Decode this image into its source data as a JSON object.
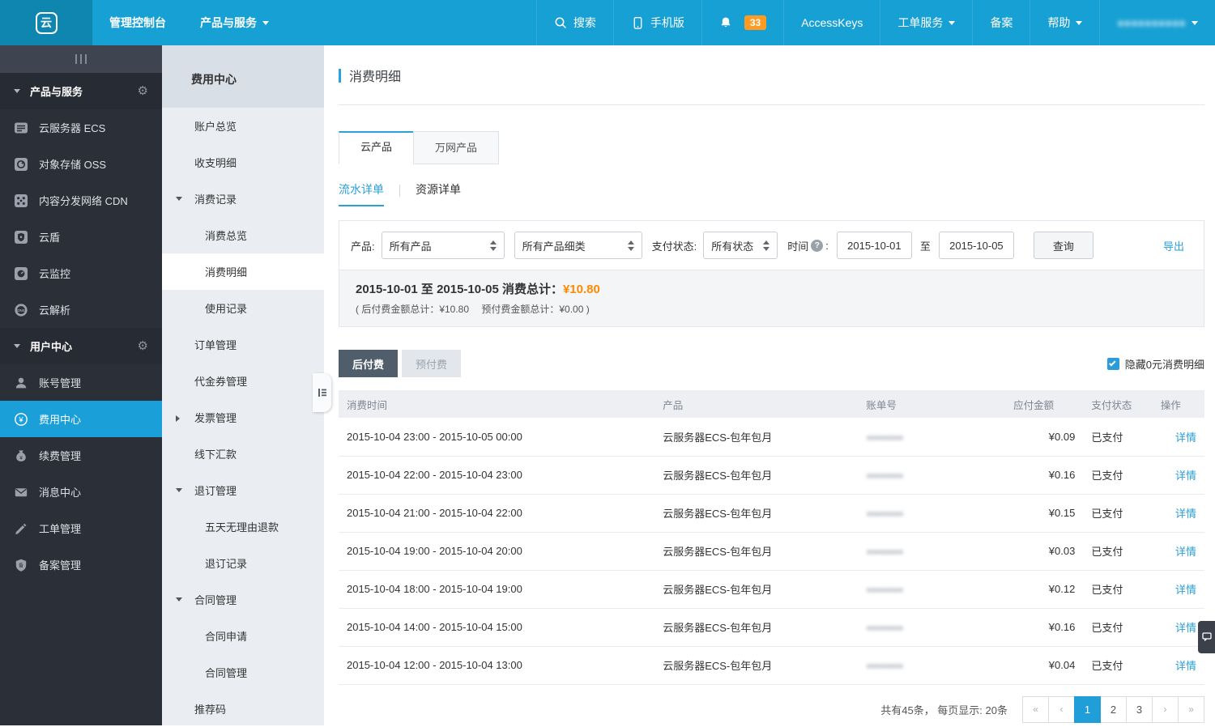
{
  "colors": {
    "accent": "#1b9fd9",
    "topbar": "#17a0d3",
    "orange": "#ff8a00",
    "green": "#3eb049",
    "sidebar_dark": "#2b2f38"
  },
  "topbar": {
    "logo_glyph": "云",
    "console": "管理控制台",
    "products": "产品与服务",
    "search": "搜索",
    "mobile": "手机版",
    "badge": "33",
    "accesskeys": "AccessKeys",
    "tickets": "工单服务",
    "beian": "备案",
    "help": "帮助",
    "user_masked": "●●●●●●●●●●"
  },
  "nav1": {
    "sec1": "产品与服务",
    "sec2": "用户中心",
    "items1": [
      "云服务器 ECS",
      "对象存储 OSS",
      "内容分发网络 CDN",
      "云盾",
      "云监控",
      "云解析"
    ],
    "items2": [
      "账号管理",
      "费用中心",
      "续费管理",
      "消息中心",
      "工单管理",
      "备案管理"
    ]
  },
  "nav2": {
    "title": "费用中心",
    "items": [
      "账户总览",
      "收支明细",
      "消费记录",
      "消费总览",
      "消费明细",
      "使用记录",
      "订单管理",
      "代金券管理",
      "发票管理",
      "线下汇款",
      "退订管理",
      "五天无理由退款",
      "退订记录",
      "合同管理",
      "合同申请",
      "合同管理",
      "推荐码"
    ]
  },
  "main": {
    "title": "消费明细",
    "tabs": [
      "云产品",
      "万网产品"
    ],
    "subtabs": [
      "流水详单",
      "资源详单"
    ],
    "filter": {
      "product_label": "产品:",
      "product": "所有产品",
      "product_sub": "所有产品细类",
      "status_label": "支付状态:",
      "status": "所有状态",
      "time_label": "时间",
      "help": "?",
      "colon": ":",
      "from": "2015-10-01",
      "to_word": "至",
      "to": "2015-10-05",
      "query": "查询",
      "export": "导出"
    },
    "summary": {
      "range": "2015-10-01 至 2015-10-05 消费总计：",
      "total": "¥10.80",
      "detail": "( 后付费金额总计：¥10.80　 预付费金额总计：¥0.00 )"
    },
    "toggles": {
      "postpaid": "后付费",
      "prepaid": "预付费",
      "hide_zero": "隐藏0元消费明细"
    },
    "table": {
      "headers": [
        "消费时间",
        "产品",
        "账单号",
        "应付金额",
        "支付状态",
        "操作"
      ],
      "rows": [
        {
          "time": "2015-10-04 23:00 - 2015-10-05 00:00",
          "product": "云服务器ECS-包年包月",
          "bill_masked": "●●●●●●●●",
          "amount": "¥0.09",
          "status": "已支付",
          "action": "详情"
        },
        {
          "time": "2015-10-04 22:00 - 2015-10-04 23:00",
          "product": "云服务器ECS-包年包月",
          "bill_masked": "●●●●●●●●",
          "amount": "¥0.16",
          "status": "已支付",
          "action": "详情"
        },
        {
          "time": "2015-10-04 21:00 - 2015-10-04 22:00",
          "product": "云服务器ECS-包年包月",
          "bill_masked": "●●●●●●●●",
          "amount": "¥0.15",
          "status": "已支付",
          "action": "详情"
        },
        {
          "time": "2015-10-04 19:00 - 2015-10-04 20:00",
          "product": "云服务器ECS-包年包月",
          "bill_masked": "●●●●●●●●",
          "amount": "¥0.03",
          "status": "已支付",
          "action": "详情"
        },
        {
          "time": "2015-10-04 18:00 - 2015-10-04 19:00",
          "product": "云服务器ECS-包年包月",
          "bill_masked": "●●●●●●●●",
          "amount": "¥0.12",
          "status": "已支付",
          "action": "详情"
        },
        {
          "time": "2015-10-04 14:00 - 2015-10-04 15:00",
          "product": "云服务器ECS-包年包月",
          "bill_masked": "●●●●●●●●",
          "amount": "¥0.16",
          "status": "已支付",
          "action": "详情"
        },
        {
          "time": "2015-10-04 12:00 - 2015-10-04 13:00",
          "product": "云服务器ECS-包年包月",
          "bill_masked": "●●●●●●●●",
          "amount": "¥0.04",
          "status": "已支付",
          "action": "详情"
        }
      ]
    },
    "footer": {
      "count": "共有45条， 每页显示: 20条",
      "pages": [
        "«",
        "‹",
        "1",
        "2",
        "3",
        "›",
        "»"
      ]
    }
  }
}
